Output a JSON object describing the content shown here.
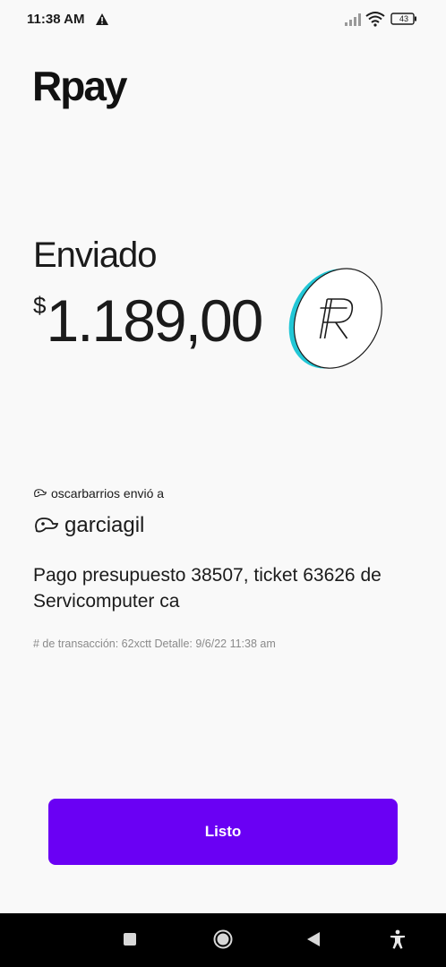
{
  "status_bar": {
    "time": "11:38 AM",
    "battery": "43",
    "icons": [
      "warning-icon",
      "signal-icon",
      "wifi-icon",
      "battery-icon"
    ]
  },
  "app": {
    "logo": "Rpay"
  },
  "transaction": {
    "status": "Enviado",
    "currency_symbol": "$",
    "amount": "1.189,00",
    "sender_text": "oscarbarrios envió a",
    "recipient": "garciagil",
    "description": "Pago presupuesto 38507, ticket 63626 de Servicomputer ca",
    "meta": "# de transacción: 62xctt Detalle: 9/6/22 11:38 am"
  },
  "actions": {
    "done_label": "Listo"
  },
  "colors": {
    "accent": "#6a00f4",
    "coin_edge": "#22c7d6",
    "background": "#f9f9f9"
  },
  "nav_bar": {
    "icons": [
      "recents-icon",
      "home-icon",
      "back-icon",
      "accessibility-icon"
    ]
  }
}
